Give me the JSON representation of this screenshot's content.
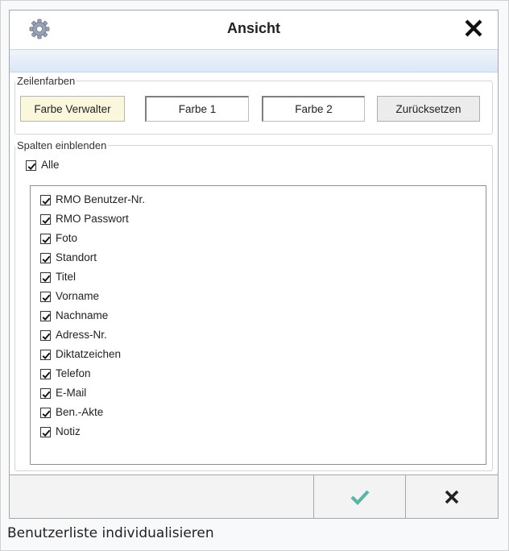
{
  "dialog": {
    "title": "Ansicht",
    "icons": {
      "settings": "gear-icon",
      "close": "close-icon"
    }
  },
  "row_colors": {
    "legend": "Zeilenfarben",
    "buttons": {
      "manager": "Farbe Verwalter",
      "color1": "Farbe 1",
      "color2": "Farbe 2",
      "reset": "Zurücksetzen"
    }
  },
  "columns": {
    "legend": "Spalten einblenden",
    "all_label": "Alle",
    "all_checked": true,
    "items": [
      {
        "label": "RMO Benutzer-Nr.",
        "checked": true
      },
      {
        "label": "RMO Passwort",
        "checked": true
      },
      {
        "label": "Foto",
        "checked": true
      },
      {
        "label": "Standort",
        "checked": true
      },
      {
        "label": "Titel",
        "checked": true
      },
      {
        "label": "Vorname",
        "checked": true
      },
      {
        "label": "Nachname",
        "checked": true
      },
      {
        "label": "Adress-Nr.",
        "checked": true
      },
      {
        "label": "Diktatzeichen",
        "checked": true
      },
      {
        "label": "Telefon",
        "checked": true
      },
      {
        "label": "E-Mail",
        "checked": true
      },
      {
        "label": "Ben.-Akte",
        "checked": true
      },
      {
        "label": "Notiz",
        "checked": true
      }
    ]
  },
  "footer": {
    "ok_icon": "checkmark-icon",
    "cancel_icon": "cross-icon"
  },
  "caption": "Benutzerliste individualisieren",
  "colors": {
    "ok_green": "#5ab5a5",
    "manager_button_bg": "#fbf7dc",
    "stripe": "#dbe8f6"
  }
}
